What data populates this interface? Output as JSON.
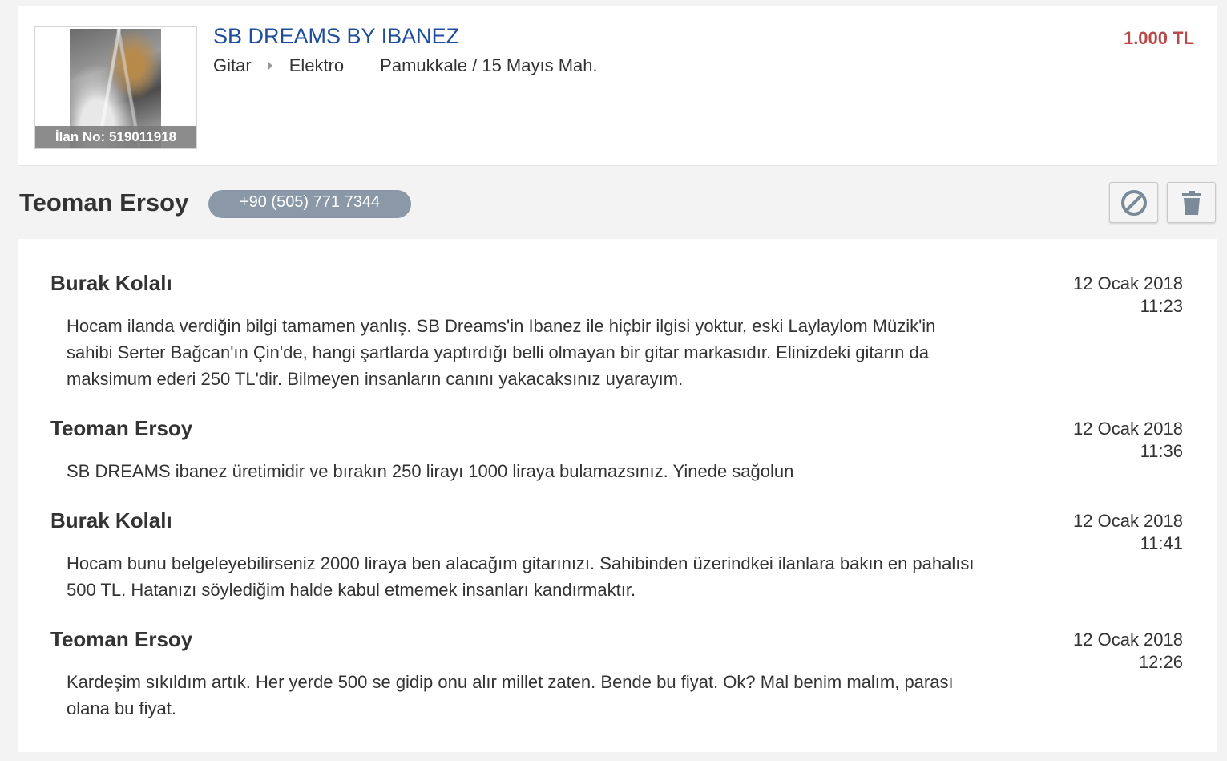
{
  "listing": {
    "title": "SB DREAMS BY IBANEZ",
    "category": "Gitar",
    "subcategory": "Elektro",
    "location": "Pamukkale / 15 Mayıs Mah.",
    "price": "1.000 TL",
    "listing_no": "İlan No: 519011918"
  },
  "seller": {
    "name": "Teoman Ersoy",
    "phone": "+90 (505) 771 7344"
  },
  "actions": {
    "block_icon": "block-icon",
    "delete_icon": "trash-icon"
  },
  "messages": [
    {
      "author": "Burak Kolalı",
      "date": "12 Ocak 2018",
      "time": "11:23",
      "text": "Hocam ilanda verdiğin bilgi tamamen yanlış. SB Dreams'in Ibanez ile hiçbir ilgisi yoktur, eski Laylaylom Müzik'in sahibi Serter Bağcan'ın Çin'de, hangi şartlarda yaptırdığı belli olmayan bir gitar markasıdır. Elinizdeki gitarın da maksimum ederi 250 TL'dir. Bilmeyen insanların canını yakacaksınız uyarayım."
    },
    {
      "author": "Teoman Ersoy",
      "date": "12 Ocak 2018",
      "time": "11:36",
      "text": "SB DREAMS ibanez üretimidir ve bırakın 250 lirayı 1000 liraya bulamazsınız. Yinede sağolun"
    },
    {
      "author": "Burak Kolalı",
      "date": "12 Ocak 2018",
      "time": "11:41",
      "text": "Hocam bunu belgeleyebilirseniz 2000 liraya ben alacağım gitarınızı. Sahibinden üzerindkei ilanlara bakın en pahalısı 500 TL. Hatanızı söylediğim halde kabul etmemek insanları kandırmaktır."
    },
    {
      "author": "Teoman Ersoy",
      "date": "12 Ocak 2018",
      "time": "12:26",
      "text": "Kardeşim sıkıldım artık. Her yerde 500 se gidip onu alır millet zaten. Bende bu fiyat. Ok? Mal benim malım, parası olana bu fiyat."
    }
  ]
}
